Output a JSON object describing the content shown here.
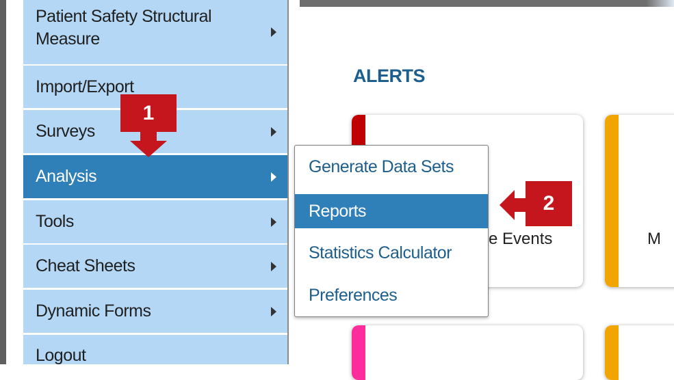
{
  "sidebar": {
    "items": [
      {
        "label": "Patient Safety Structural Measure",
        "has_submenu": true
      },
      {
        "label": "Import/Export",
        "has_submenu": false
      },
      {
        "label": "Surveys",
        "has_submenu": true
      },
      {
        "label": "Analysis",
        "has_submenu": true,
        "active": true
      },
      {
        "label": "Tools",
        "has_submenu": true
      },
      {
        "label": "Cheat Sheets",
        "has_submenu": true
      },
      {
        "label": "Dynamic Forms",
        "has_submenu": true
      },
      {
        "label": "Logout",
        "has_submenu": false
      }
    ]
  },
  "alerts": {
    "title": "ALERTS",
    "cards": [
      {
        "accent": "#c00000",
        "text": "e Events"
      },
      {
        "accent": "#f0a500",
        "text": "M"
      },
      {
        "accent": "#ff2d9c",
        "text": ""
      },
      {
        "accent": "#f0a500",
        "text": ""
      }
    ]
  },
  "dropdown": {
    "items": [
      {
        "label": "Generate Data Sets"
      },
      {
        "label": "Reports",
        "active": true
      },
      {
        "label": "Statistics Calculator"
      },
      {
        "label": "Preferences"
      }
    ]
  },
  "annotations": {
    "step1": "1",
    "step2": "2",
    "marker_color": "#c4161c"
  },
  "colors": {
    "sidebar_bg": "#b3d7f4",
    "active_bg": "#2f7fb8",
    "link_text": "#1d5f8c"
  }
}
